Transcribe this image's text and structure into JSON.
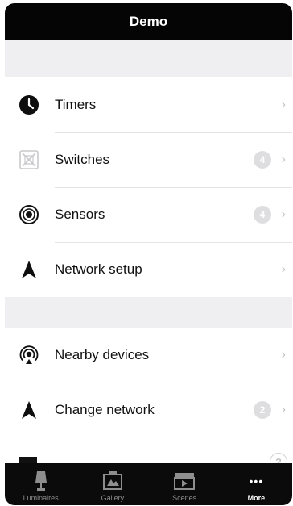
{
  "header": {
    "title": "Demo"
  },
  "groups": [
    {
      "items": [
        {
          "label": "Timers",
          "icon": "clock-icon",
          "badge": ""
        },
        {
          "label": "Switches",
          "icon": "switch-icon",
          "badge": "4"
        },
        {
          "label": "Sensors",
          "icon": "sensor-icon",
          "badge": "4"
        },
        {
          "label": "Network setup",
          "icon": "network-arrow-icon",
          "badge": ""
        }
      ]
    },
    {
      "items": [
        {
          "label": "Nearby devices",
          "icon": "nearby-devices-icon",
          "badge": ""
        },
        {
          "label": "Change network",
          "icon": "network-arrow-icon",
          "badge": "2"
        }
      ]
    }
  ],
  "help_label": "?",
  "tabbar": {
    "items": [
      {
        "label": "Luminaires",
        "icon": "lamp-icon",
        "active": false
      },
      {
        "label": "Gallery",
        "icon": "gallery-icon",
        "active": false
      },
      {
        "label": "Scenes",
        "icon": "scenes-icon",
        "active": false
      },
      {
        "label": "More",
        "icon": "more-icon",
        "active": true,
        "glyph": "•••"
      }
    ]
  }
}
